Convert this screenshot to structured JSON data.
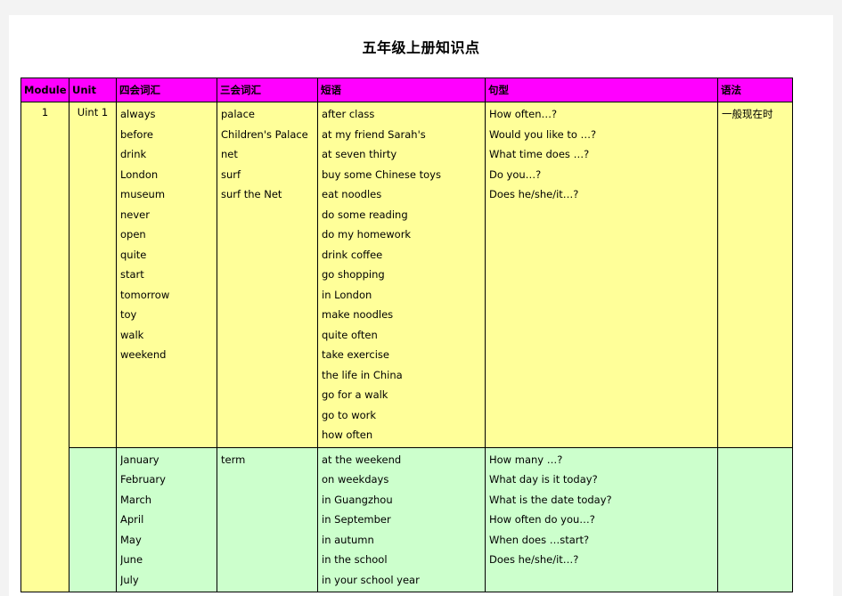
{
  "document": {
    "title": "五年级上册知识点"
  },
  "colors": {
    "header_background": "#ff00ff",
    "module_background": "#00ee00",
    "row1_background": "#ffff99",
    "row2_background": "#ccffcc",
    "page_background": "#ffffff",
    "app_background": "#f3f3f3",
    "border": "#000000"
  },
  "table": {
    "headers": [
      {
        "key": "module",
        "label": "Module"
      },
      {
        "key": "unit",
        "label": "Unit"
      },
      {
        "key": "four_skills",
        "label": "四会词汇"
      },
      {
        "key": "three_skills",
        "label": "三会词汇"
      },
      {
        "key": "phrases",
        "label": "短语"
      },
      {
        "key": "sentences",
        "label": "句型"
      },
      {
        "key": "grammar",
        "label": "语法"
      }
    ],
    "module_label": "1",
    "rows": [
      {
        "unit": "Uint 1",
        "four_skills": [
          "always",
          "before",
          "drink",
          "London",
          "museum",
          "never",
          "open",
          "quite",
          "start",
          "tomorrow",
          "toy",
          "walk",
          "weekend"
        ],
        "three_skills": [
          "palace",
          "Children's Palace",
          "net",
          "surf",
          "surf the Net"
        ],
        "phrases": [
          "after class",
          "at my friend Sarah's",
          "at seven thirty",
          "buy some Chinese toys",
          "eat noodles",
          "do some reading",
          "do my homework",
          "drink coffee",
          "go shopping",
          "in London",
          "make noodles",
          "quite often",
          "take exercise",
          "the life in China",
          "go for a walk",
          "go to work",
          "how often"
        ],
        "sentences": [
          "How often…?",
          "Would you like to …?",
          "What time does …?",
          "Do you…?",
          "Does he/she/it…?"
        ],
        "grammar": [
          "一般现在时"
        ]
      },
      {
        "unit": "",
        "four_skills": [
          "January",
          "February",
          "March",
          "April",
          "May",
          "June",
          "July"
        ],
        "three_skills": [
          "term"
        ],
        "phrases": [
          "at the weekend",
          "on weekdays",
          "in Guangzhou",
          "in September",
          "in autumn",
          "in the school",
          "in your school year"
        ],
        "sentences": [
          "How many …?",
          "What day is it today?",
          "What is the date today?",
          "How often do you…?",
          "When does …start?",
          "Does he/she/it…?"
        ],
        "grammar": []
      }
    ]
  }
}
